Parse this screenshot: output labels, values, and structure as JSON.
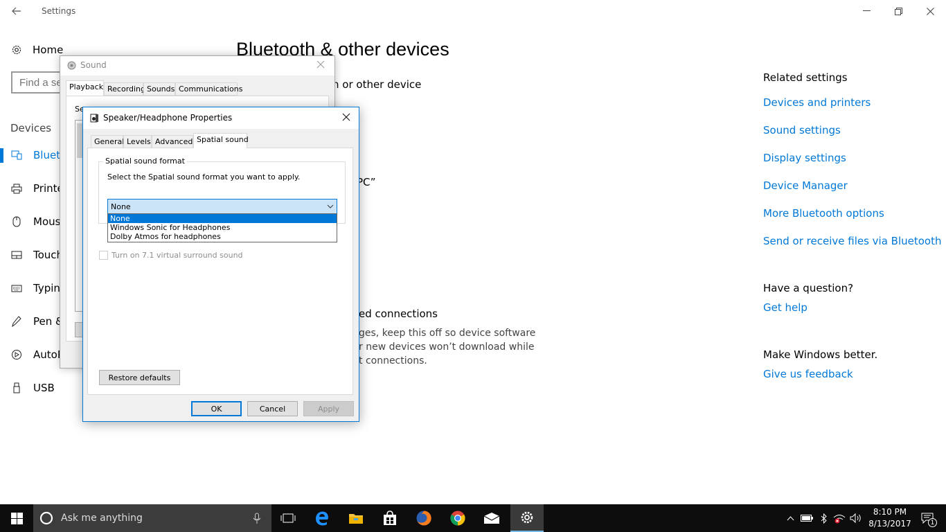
{
  "settings_window": {
    "title": "Settings",
    "home_label": "Home",
    "search_placeholder": "Find a se",
    "section_label": "Devices",
    "nav": [
      {
        "label": "Blueto",
        "icon": "bluetooth-devices-icon"
      },
      {
        "label": "Printe",
        "icon": "printer-icon"
      },
      {
        "label": "Mouse",
        "icon": "mouse-icon"
      },
      {
        "label": "Touch",
        "icon": "touchpad-icon"
      },
      {
        "label": "Typing",
        "icon": "keyboard-icon"
      },
      {
        "label": "Pen &",
        "icon": "pen-icon"
      },
      {
        "label": "AutoP",
        "icon": "autoplay-icon"
      },
      {
        "label": "USB",
        "icon": "usb-icon"
      }
    ],
    "page_title": "Bluetooth & other devices",
    "behind_text": {
      "add_device": "h or other device",
      "pc_name": "PC”",
      "metered_heading": "ed connections",
      "metered_line1": "ges, keep this off so device software",
      "metered_line2": "r new devices won’t download while",
      "metered_line3": "t connections."
    },
    "related": {
      "heading": "Related settings",
      "links": [
        "Devices and printers",
        "Sound settings",
        "Display settings",
        "Device Manager",
        "More Bluetooth options",
        "Send or receive files via Bluetooth"
      ]
    },
    "question": {
      "heading": "Have a question?",
      "link": "Get help"
    },
    "feedback": {
      "heading": "Make Windows better.",
      "link": "Give us feedback"
    }
  },
  "sound_dialog": {
    "title": "Sound",
    "tabs": [
      "Playback",
      "Recording",
      "Sounds",
      "Communications"
    ],
    "instruction_partial": "Se"
  },
  "props_dialog": {
    "title": "Speaker/Headphone Properties",
    "tabs": [
      "General",
      "Levels",
      "Advanced",
      "Spatial sound"
    ],
    "group_label": "Spatial sound format",
    "instruction": "Select the Spatial sound format you want to apply.",
    "selected_value": "None",
    "options": [
      "None",
      "Windows Sonic for Headphones",
      "Dolby Atmos for headphones"
    ],
    "checkbox_label": "Turn on 7.1 virtual surround sound",
    "restore_label": "Restore defaults",
    "ok_label": "OK",
    "cancel_label": "Cancel",
    "apply_label": "Apply"
  },
  "taskbar": {
    "search_placeholder": "Ask me anything",
    "time": "8:10 PM",
    "date": "8/13/2017",
    "notification_count": "1"
  },
  "colors": {
    "accent": "#0078d7",
    "taskbar": "#0d0d0d",
    "dropdown_highlight": "#0078d7"
  }
}
